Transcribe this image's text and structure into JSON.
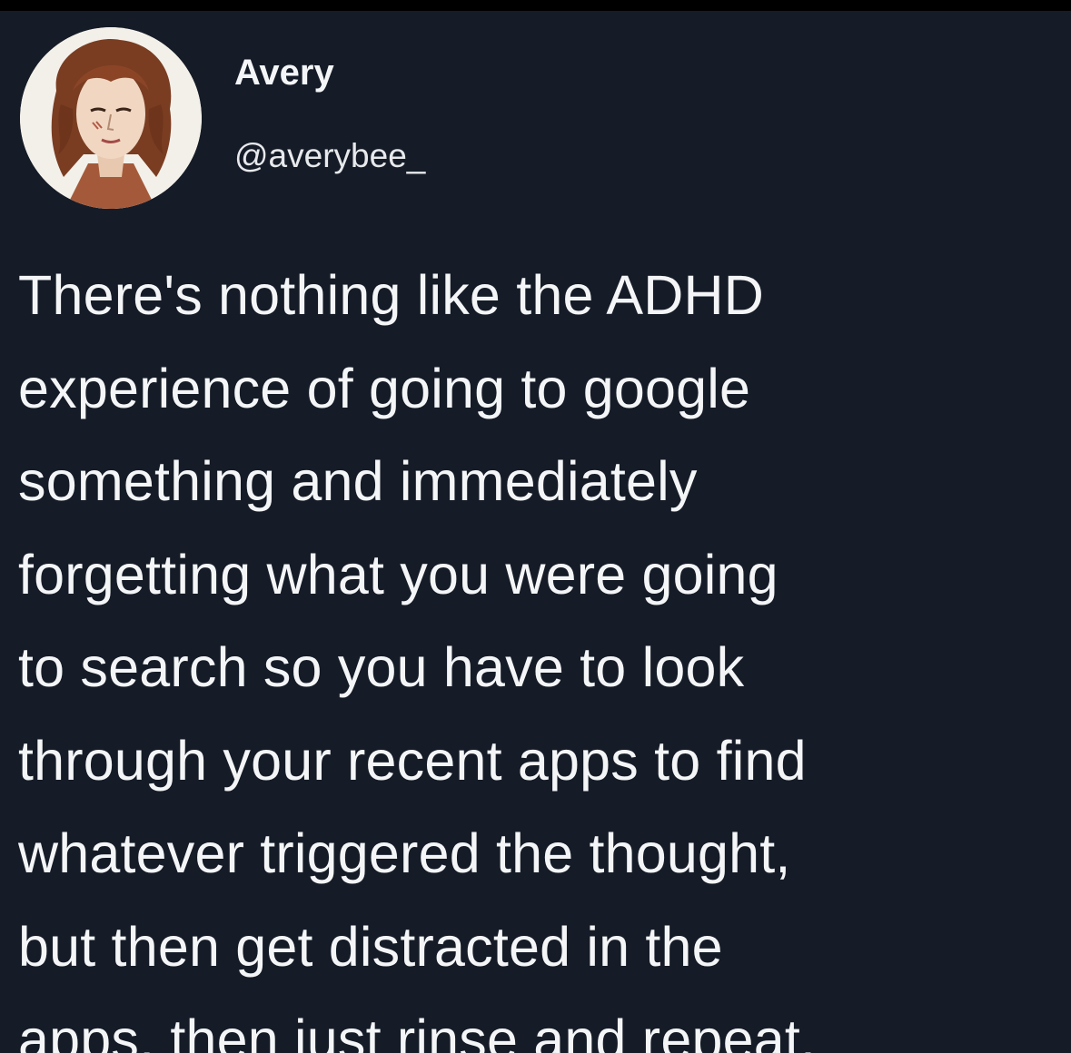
{
  "colors": {
    "background": "#151c27",
    "text": "#f4f5f7",
    "top_bar": "#000000"
  },
  "author": {
    "display_name": "Avery",
    "handle": "@averybee_",
    "avatar_icon": "drawn-portrait-avatar"
  },
  "tweet": {
    "lines": [
      "There's nothing like the ADHD",
      "experience of going to google",
      "something and immediately",
      "forgetting what you were going",
      "to search so you have to look",
      "through your recent apps to find",
      "whatever triggered the thought,",
      "but then get distracted in the",
      "apps, then just rinse and repeat."
    ]
  }
}
